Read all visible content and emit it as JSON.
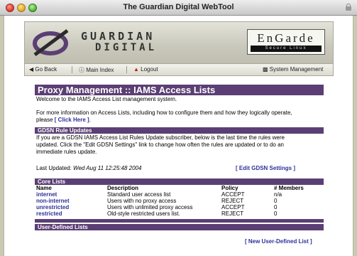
{
  "window": {
    "title": "The Guardian Digital WebTool"
  },
  "header": {
    "brand_line1": "GUARDIAN",
    "brand_line2": "DIGITAL",
    "product_name": "EnGarde",
    "product_sub": "Secure Linux"
  },
  "nav": {
    "go_back": "Go Back",
    "main_index": "Main Index",
    "logout": "Logout",
    "system_management": "System Management"
  },
  "page": {
    "title": "Proxy Management :: IAMS Access Lists",
    "welcome": "Welcome to the IAMS Access List management system.",
    "info_line1": "For more information on Access Lists, including how to configure them and how they logically operate,",
    "info_line2_prefix": "please ",
    "click_here": "[ Click Here ]",
    "info_line2_suffix": "."
  },
  "gdsn": {
    "heading": "GDSN Rule Updates",
    "text_line1": "If you are a GDSN IAMS Access List Rules Update subscriber, below is the last time the rules were",
    "text_line2": "updated. Click the \"Edit GDSN Settings\" link to change how often the rules are updated or to do an",
    "text_line3": "immediate rules update.",
    "last_updated_label": "Last Updated:",
    "last_updated_value": "Wed Aug 11 12:25:48 2004",
    "edit_link": "[ Edit GDSN Settings ]"
  },
  "core_lists": {
    "heading": "Core Lists",
    "columns": [
      "Name",
      "Description",
      "Policy",
      "# Members"
    ],
    "rows": [
      {
        "name": "internet",
        "description": "Standard user access list",
        "policy": "ACCEPT",
        "members": "n/a"
      },
      {
        "name": "non-internet",
        "description": "Users with no proxy access",
        "policy": "REJECT",
        "members": "0"
      },
      {
        "name": "unrestricted",
        "description": "Users with unlimited proxy access",
        "policy": "ACCEPT",
        "members": "0"
      },
      {
        "name": "restricted",
        "description": "Old-style restricted users list.",
        "policy": "REJECT",
        "members": "0"
      }
    ]
  },
  "user_defined": {
    "heading": "User-Defined Lists",
    "new_link": "[ New User-Defined List ]"
  },
  "colors": {
    "section_bar": "#5b3f74",
    "link": "#2d2f99",
    "desktop": "#c9c9b4"
  }
}
